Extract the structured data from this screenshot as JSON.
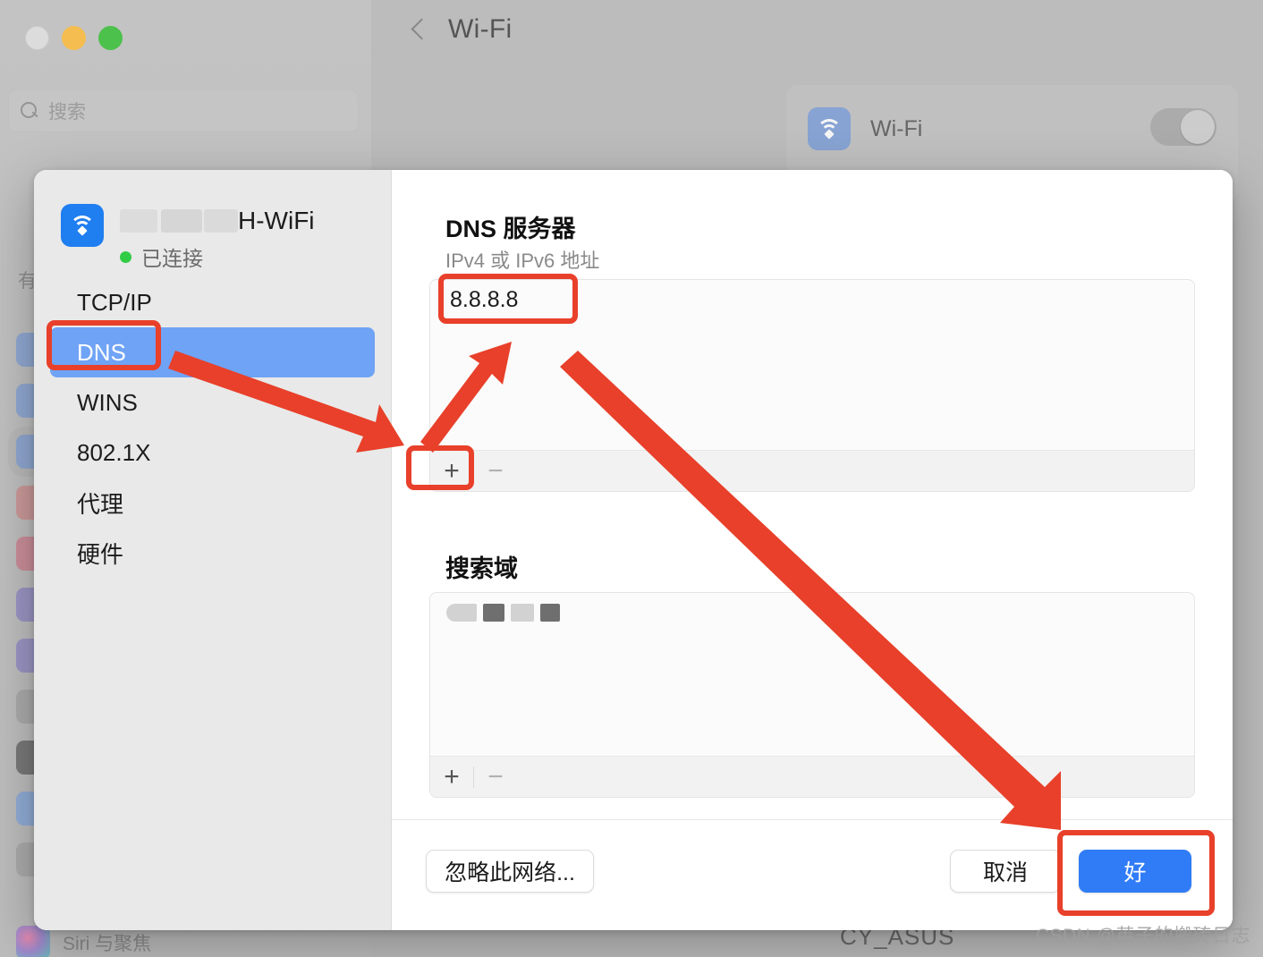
{
  "window": {
    "traffic_lights": [
      "close",
      "minimize",
      "zoom"
    ],
    "search": {
      "placeholder": "搜索",
      "value": "",
      "icon": "search-icon"
    },
    "sidebar_partial_label": "有",
    "siri_item": {
      "label": "Siri 与聚焦",
      "icon": "siri-icon"
    },
    "back_label": "",
    "title": "Wi-Fi",
    "wifi_row": {
      "label": "Wi-Fi",
      "icon": "wifi-icon",
      "toggle_state": "on"
    },
    "background_network": "CY_ASUS"
  },
  "sheet": {
    "network": {
      "name_visible_suffix": "H-WiFi",
      "name_redacted": true,
      "status": "已连接",
      "status_dot_color": "#31cc45",
      "icon": "wifi-icon"
    },
    "tabs": [
      {
        "label": "TCP/IP",
        "active": false
      },
      {
        "label": "DNS",
        "active": true
      },
      {
        "label": "WINS",
        "active": false
      },
      {
        "label": "802.1X",
        "active": false
      },
      {
        "label": "代理",
        "active": false
      },
      {
        "label": "硬件",
        "active": false
      }
    ],
    "dns": {
      "title": "DNS 服务器",
      "subtitle": "IPv4 或 IPv6 地址",
      "servers": [
        "8.8.8.8"
      ],
      "add_label": "+",
      "remove_label": "−",
      "remove_disabled": true
    },
    "search_domains": {
      "title": "搜索域",
      "entries_redacted": true,
      "entries": [
        ""
      ],
      "add_label": "+",
      "remove_label": "−",
      "remove_disabled": true
    },
    "buttons": {
      "forget": "忽略此网络...",
      "cancel": "取消",
      "ok": "好"
    }
  },
  "annotations": {
    "color": "#e8402a",
    "boxes": [
      "dns-tab",
      "dns-server-value",
      "dns-add-button",
      "ok-button"
    ],
    "arrows": [
      "dns-tab-to-add-button",
      "add-button-to-dns-value",
      "dns-value-to-ok-button"
    ]
  },
  "watermark": "CSDN @英子的搬砖日志",
  "colors": {
    "accent_blue": "#2f7cf6",
    "selection_blue": "#6fa3f5",
    "annotation_red": "#e8402a",
    "status_green": "#31cc45"
  }
}
